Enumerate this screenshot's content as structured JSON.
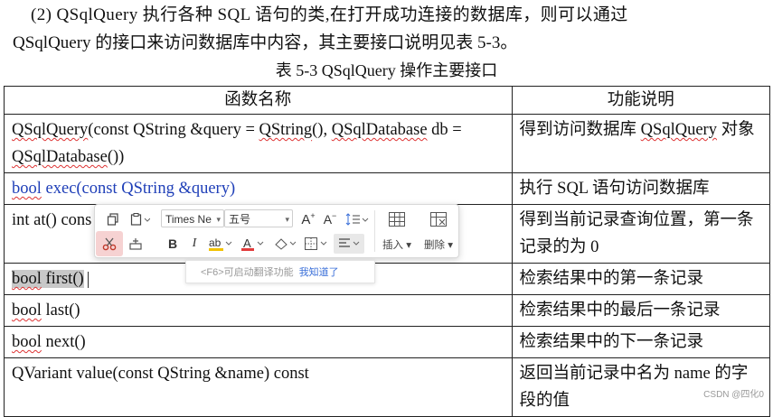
{
  "paragraph": {
    "line1": "(2)  QSqlQuery 执行各种 SQL 语句的类,在打开成功连接的数据库，则可以通过",
    "line2": "QSqlQuery 的接口来访问数据库中内容，其主要接口说明见表 5-3。"
  },
  "table": {
    "caption": "表 5-3 QSqlQuery 操作主要接口",
    "headers": [
      "函数名称",
      "功能说明"
    ],
    "rows": [
      {
        "name_parts": [
          "QSqlQuery",
          "(const QString &query = ",
          "QString",
          "(), ",
          "QSqlDatabase",
          " db = ",
          "QSqlDatabase",
          "())"
        ],
        "desc_parts": [
          "得到访问数据库 ",
          "QSqlQuery",
          " 对象"
        ]
      },
      {
        "name_parts": [
          "bool",
          " exec(const QString &query)"
        ],
        "desc": "执行 SQL 语句访问数据库"
      },
      {
        "name": "int at() const",
        "name_visible": "int at() cons",
        "desc": "得到当前记录查询位置，第一条记录的为 0"
      },
      {
        "name_parts": [
          "bool",
          " first()"
        ],
        "desc": "检索结果中的第一条记录"
      },
      {
        "name_parts": [
          "bool",
          " last()"
        ],
        "desc": "检索结果中的最后一条记录"
      },
      {
        "name_parts": [
          "bool",
          " next()"
        ],
        "desc": "检索结果中的下一条记录"
      },
      {
        "name": "QVariant value(const QString &name) const",
        "desc": "返回当前记录中名为 name 的字段的值"
      }
    ]
  },
  "toolbar": {
    "font_name": "Times Ne",
    "font_size": "五号",
    "insert_label": "插入",
    "delete_label": "删除",
    "icons": [
      "copy-icon",
      "paste-icon",
      "font-grow-icon",
      "font-shrink-icon",
      "line-spacing-icon",
      "table-insert-icon",
      "table-delete-icon",
      "cut-icon",
      "format-painter-icon",
      "bold-icon",
      "italic-icon",
      "highlight-icon",
      "font-color-icon",
      "fill-color-icon",
      "border-icon",
      "align-icon"
    ],
    "colors": {
      "highlight": "#f2c200",
      "font_color": "#e23b3b",
      "accent": "#2f66d6"
    }
  },
  "tip": {
    "text": "<F6>可启动翻译功能",
    "link": "我知道了"
  },
  "watermark": "CSDN @四化0"
}
